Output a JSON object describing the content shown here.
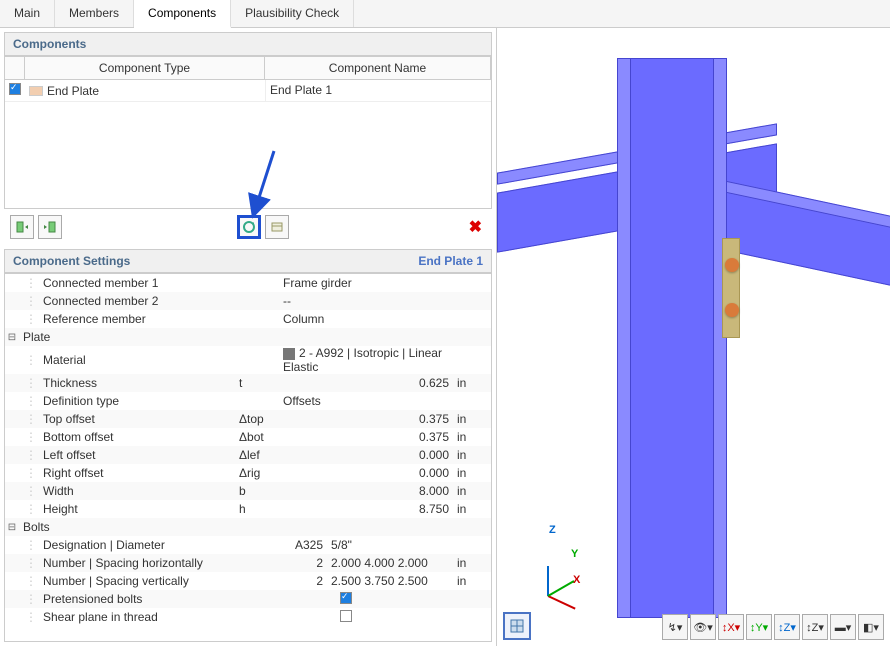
{
  "tabs": [
    "Main",
    "Members",
    "Components",
    "Plausibility Check"
  ],
  "active_tab": "Components",
  "components_panel": {
    "title": "Components",
    "columns": {
      "type": "Component Type",
      "name": "Component Name"
    },
    "rows": [
      {
        "checked": true,
        "type": "End Plate",
        "name": "End Plate 1"
      }
    ]
  },
  "settings_panel": {
    "title": "Component Settings",
    "context": "End Plate 1"
  },
  "props": {
    "connected1": {
      "label": "Connected member 1",
      "value": "Frame girder"
    },
    "connected2": {
      "label": "Connected member 2",
      "value": "--"
    },
    "reference": {
      "label": "Reference member",
      "value": "Column"
    },
    "plate": {
      "header": "Plate",
      "material": {
        "label": "Material",
        "value": "2 - A992 | Isotropic | Linear Elastic"
      },
      "thickness": {
        "label": "Thickness",
        "sym": "t",
        "value": "0.625",
        "unit": "in"
      },
      "deftype": {
        "label": "Definition type",
        "value": "Offsets"
      },
      "top": {
        "label": "Top offset",
        "sym": "Δtop",
        "value": "0.375",
        "unit": "in"
      },
      "bot": {
        "label": "Bottom offset",
        "sym": "Δbot",
        "value": "0.375",
        "unit": "in"
      },
      "left": {
        "label": "Left offset",
        "sym": "Δlef",
        "value": "0.000",
        "unit": "in"
      },
      "right": {
        "label": "Right offset",
        "sym": "Δrig",
        "value": "0.000",
        "unit": "in"
      },
      "width": {
        "label": "Width",
        "sym": "b",
        "value": "8.000",
        "unit": "in"
      },
      "height": {
        "label": "Height",
        "sym": "h",
        "value": "8.750",
        "unit": "in"
      }
    },
    "bolts": {
      "header": "Bolts",
      "designation": {
        "label": "Designation | Diameter",
        "v1": "A325",
        "v2": "5/8\""
      },
      "horiz": {
        "label": "Number | Spacing horizontally",
        "n": "2",
        "vals": "2.000 4.000 2.000",
        "unit": "in"
      },
      "vert": {
        "label": "Number | Spacing vertically",
        "n": "2",
        "vals": "2.500 3.750 2.500",
        "unit": "in"
      },
      "pretensioned": {
        "label": "Pretensioned bolts",
        "checked": true
      },
      "shear": {
        "label": "Shear plane in thread",
        "checked": false
      }
    }
  },
  "axes": {
    "x": "X",
    "y": "Y",
    "z": "Z"
  },
  "icons": {
    "add_left": "add-left",
    "add_right": "add-right",
    "refresh": "refresh-component",
    "library": "library",
    "close": "close"
  }
}
